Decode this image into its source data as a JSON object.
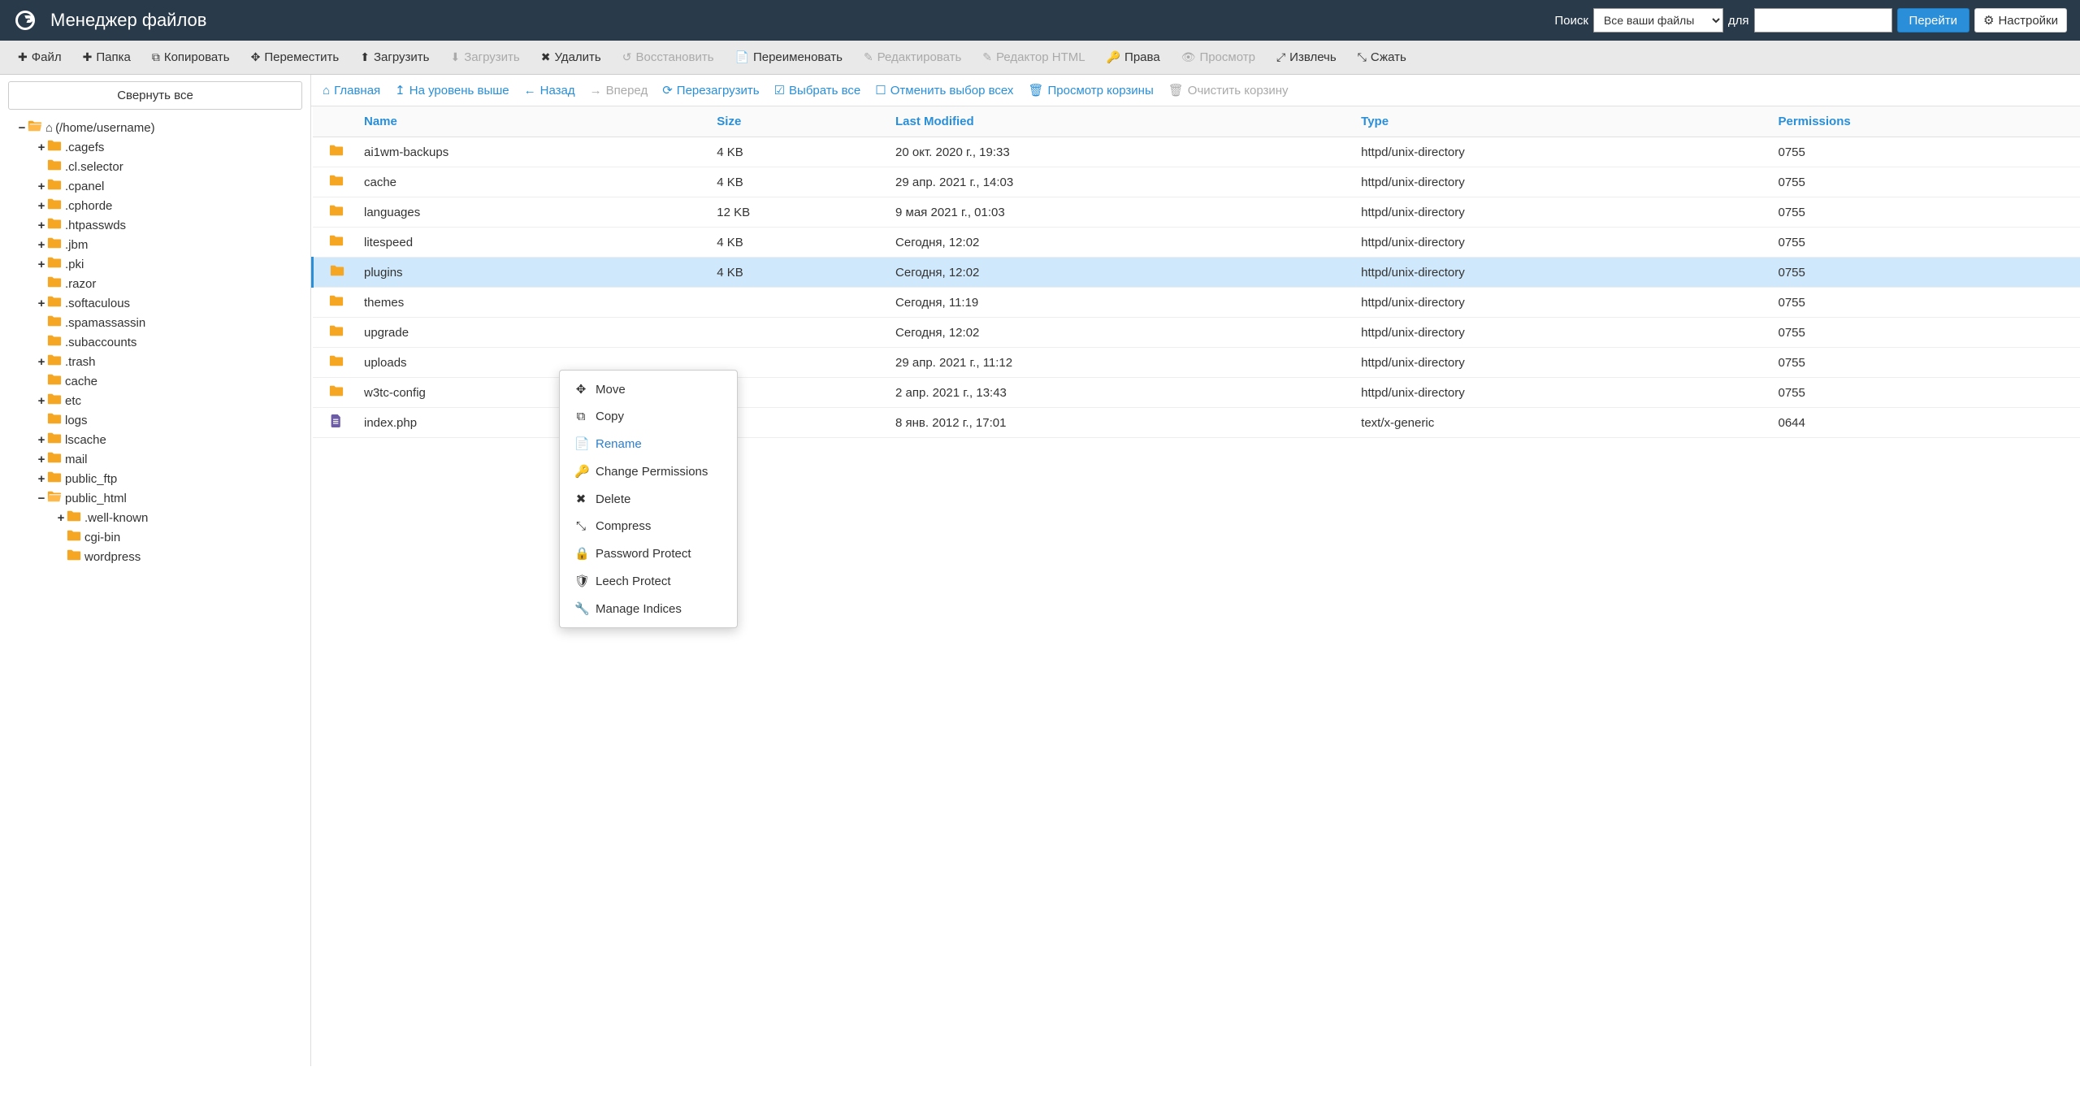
{
  "header": {
    "title": "Менеджер файлов",
    "search_label": "Поиск",
    "search_select": "Все ваши файлы",
    "for_label": "для",
    "go_label": "Перейти",
    "settings_label": "Настройки"
  },
  "toolbar": {
    "file": "Файл",
    "folder": "Папка",
    "copy": "Копировать",
    "move": "Переместить",
    "upload": "Загрузить",
    "download": "Загрузить",
    "delete": "Удалить",
    "restore": "Восстановить",
    "rename": "Переименовать",
    "edit": "Редактировать",
    "html_editor": "Редактор HTML",
    "permissions": "Права",
    "view": "Просмотр",
    "extract": "Извлечь",
    "compress": "Сжать"
  },
  "sidebar": {
    "collapse_all": "Свернуть все",
    "root_label": "(/home/username)"
  },
  "tree": [
    {
      "indent": 0,
      "toggle": "−",
      "icon": "home",
      "label": "(/home/username)"
    },
    {
      "indent": 1,
      "toggle": "+",
      "icon": "folder",
      "label": ".cagefs"
    },
    {
      "indent": 1,
      "toggle": "",
      "icon": "folder",
      "label": ".cl.selector"
    },
    {
      "indent": 1,
      "toggle": "+",
      "icon": "folder",
      "label": ".cpanel"
    },
    {
      "indent": 1,
      "toggle": "+",
      "icon": "folder",
      "label": ".cphorde"
    },
    {
      "indent": 1,
      "toggle": "+",
      "icon": "folder",
      "label": ".htpasswds"
    },
    {
      "indent": 1,
      "toggle": "+",
      "icon": "folder",
      "label": ".jbm"
    },
    {
      "indent": 1,
      "toggle": "+",
      "icon": "folder",
      "label": ".pki"
    },
    {
      "indent": 1,
      "toggle": "",
      "icon": "folder",
      "label": ".razor"
    },
    {
      "indent": 1,
      "toggle": "+",
      "icon": "folder",
      "label": ".softaculous"
    },
    {
      "indent": 1,
      "toggle": "",
      "icon": "folder",
      "label": ".spamassassin"
    },
    {
      "indent": 1,
      "toggle": "",
      "icon": "folder",
      "label": ".subaccounts"
    },
    {
      "indent": 1,
      "toggle": "+",
      "icon": "folder",
      "label": ".trash"
    },
    {
      "indent": 1,
      "toggle": "",
      "icon": "folder",
      "label": "cache"
    },
    {
      "indent": 1,
      "toggle": "+",
      "icon": "folder",
      "label": "etc"
    },
    {
      "indent": 1,
      "toggle": "",
      "icon": "folder",
      "label": "logs"
    },
    {
      "indent": 1,
      "toggle": "+",
      "icon": "folder",
      "label": "lscache"
    },
    {
      "indent": 1,
      "toggle": "+",
      "icon": "folder",
      "label": "mail"
    },
    {
      "indent": 1,
      "toggle": "+",
      "icon": "folder",
      "label": "public_ftp"
    },
    {
      "indent": 1,
      "toggle": "−",
      "icon": "folder",
      "label": "public_html"
    },
    {
      "indent": 2,
      "toggle": "+",
      "icon": "folder",
      "label": ".well-known"
    },
    {
      "indent": 2,
      "toggle": "",
      "icon": "folder",
      "label": "cgi-bin"
    },
    {
      "indent": 2,
      "toggle": "",
      "icon": "folder",
      "label": "wordpress"
    }
  ],
  "nav": {
    "home": "Главная",
    "up": "На уровень выше",
    "back": "Назад",
    "forward": "Вперед",
    "reload": "Перезагрузить",
    "select_all": "Выбрать все",
    "deselect": "Отменить выбор всех",
    "view_trash": "Просмотр корзины",
    "empty_trash": "Очистить корзину"
  },
  "table": {
    "columns": {
      "name": "Name",
      "size": "Size",
      "modified": "Last Modified",
      "type": "Type",
      "perms": "Permissions"
    },
    "rows": [
      {
        "icon": "folder",
        "name": "ai1wm-backups",
        "size": "4 KB",
        "modified": "20 окт. 2020 г., 19:33",
        "type": "httpd/unix-directory",
        "perms": "0755",
        "selected": false
      },
      {
        "icon": "folder",
        "name": "cache",
        "size": "4 KB",
        "modified": "29 апр. 2021 г., 14:03",
        "type": "httpd/unix-directory",
        "perms": "0755",
        "selected": false
      },
      {
        "icon": "folder",
        "name": "languages",
        "size": "12 KB",
        "modified": "9 мая 2021 г., 01:03",
        "type": "httpd/unix-directory",
        "perms": "0755",
        "selected": false
      },
      {
        "icon": "folder",
        "name": "litespeed",
        "size": "4 KB",
        "modified": "Сегодня, 12:02",
        "type": "httpd/unix-directory",
        "perms": "0755",
        "selected": false
      },
      {
        "icon": "folder",
        "name": "plugins",
        "size": "4 KB",
        "modified": "Сегодня, 12:02",
        "type": "httpd/unix-directory",
        "perms": "0755",
        "selected": true
      },
      {
        "icon": "folder",
        "name": "themes",
        "size": "",
        "modified": "Сегодня, 11:19",
        "type": "httpd/unix-directory",
        "perms": "0755",
        "selected": false
      },
      {
        "icon": "folder",
        "name": "upgrade",
        "size": "",
        "modified": "Сегодня, 12:02",
        "type": "httpd/unix-directory",
        "perms": "0755",
        "selected": false
      },
      {
        "icon": "folder",
        "name": "uploads",
        "size": "",
        "modified": "29 апр. 2021 г., 11:12",
        "type": "httpd/unix-directory",
        "perms": "0755",
        "selected": false
      },
      {
        "icon": "folder",
        "name": "w3tc-config",
        "size": "",
        "modified": "2 апр. 2021 г., 13:43",
        "type": "httpd/unix-directory",
        "perms": "0755",
        "selected": false
      },
      {
        "icon": "file",
        "name": "index.php",
        "size": "",
        "modified": "8 янв. 2012 г., 17:01",
        "type": "text/x-generic",
        "perms": "0644",
        "selected": false
      }
    ]
  },
  "context_menu": {
    "move": "Move",
    "copy": "Copy",
    "rename": "Rename",
    "chperm": "Change Permissions",
    "delete": "Delete",
    "compress": "Compress",
    "password": "Password Protect",
    "leech": "Leech Protect",
    "indices": "Manage Indices"
  }
}
